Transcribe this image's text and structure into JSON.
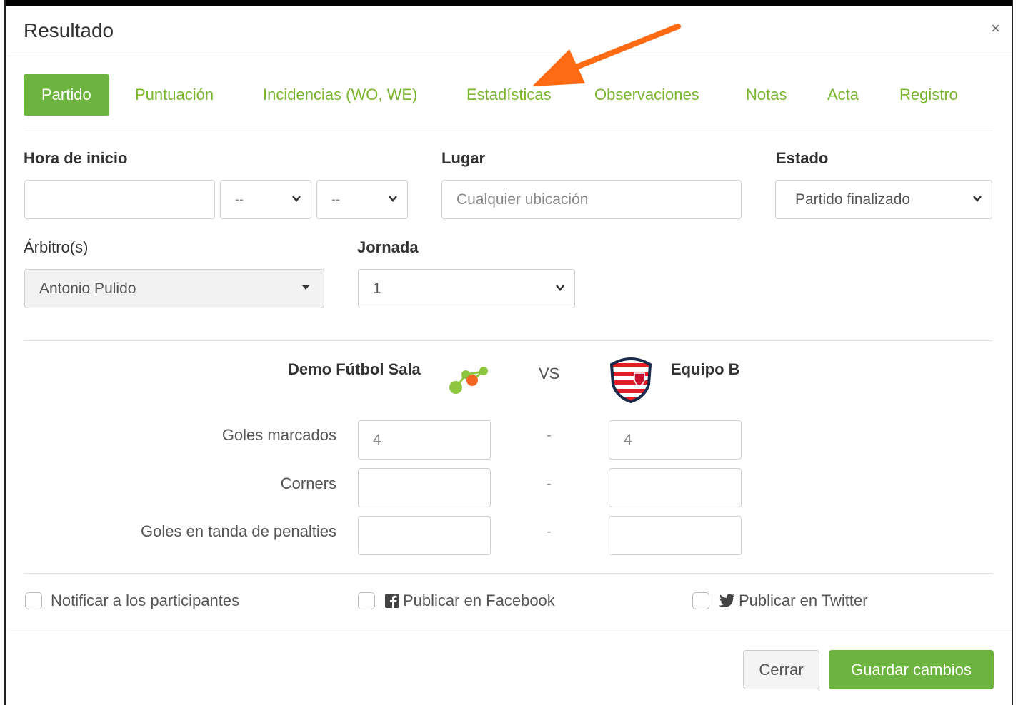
{
  "header": {
    "title": "Resultado",
    "close_glyph": "×"
  },
  "tabs": [
    {
      "label": "Partido",
      "active": true
    },
    {
      "label": "Puntuación",
      "active": false
    },
    {
      "label": "Incidencias (WO, WE)",
      "active": false
    },
    {
      "label": "Estadísticas",
      "active": false
    },
    {
      "label": "Observaciones",
      "active": false
    },
    {
      "label": "Notas",
      "active": false
    },
    {
      "label": "Acta",
      "active": false
    },
    {
      "label": "Registro",
      "active": false
    }
  ],
  "form": {
    "start_time": {
      "label": "Hora de inicio",
      "date_value": "",
      "hour_value": "--",
      "minute_value": "--"
    },
    "place": {
      "label": "Lugar",
      "placeholder": "Cualquier ubicación"
    },
    "status": {
      "label": "Estado",
      "value": "Partido finalizado"
    },
    "referees": {
      "label": "Árbitro(s)",
      "value": "Antonio Pulido"
    },
    "round": {
      "label": "Jornada",
      "value": "1"
    }
  },
  "match": {
    "home_team": "Demo Fútbol Sala",
    "vs": "VS",
    "away_team": "Equipo B",
    "rows": [
      {
        "label": "Goles marcados",
        "home": "4",
        "away": "4",
        "separator": "-"
      },
      {
        "label": "Corners",
        "home": "",
        "away": "",
        "separator": "-"
      },
      {
        "label": "Goles en tanda de penalties",
        "home": "",
        "away": "",
        "separator": "-"
      }
    ]
  },
  "options": {
    "notify": "Notificar a los participantes",
    "facebook": "Publicar en Facebook",
    "twitter": "Publicar en Twitter"
  },
  "buttons": {
    "close": "Cerrar",
    "save": "Guardar cambios"
  },
  "colors": {
    "accent": "#6cb33f",
    "tab_text": "#7ab52e",
    "arrow": "#ff6a13"
  }
}
